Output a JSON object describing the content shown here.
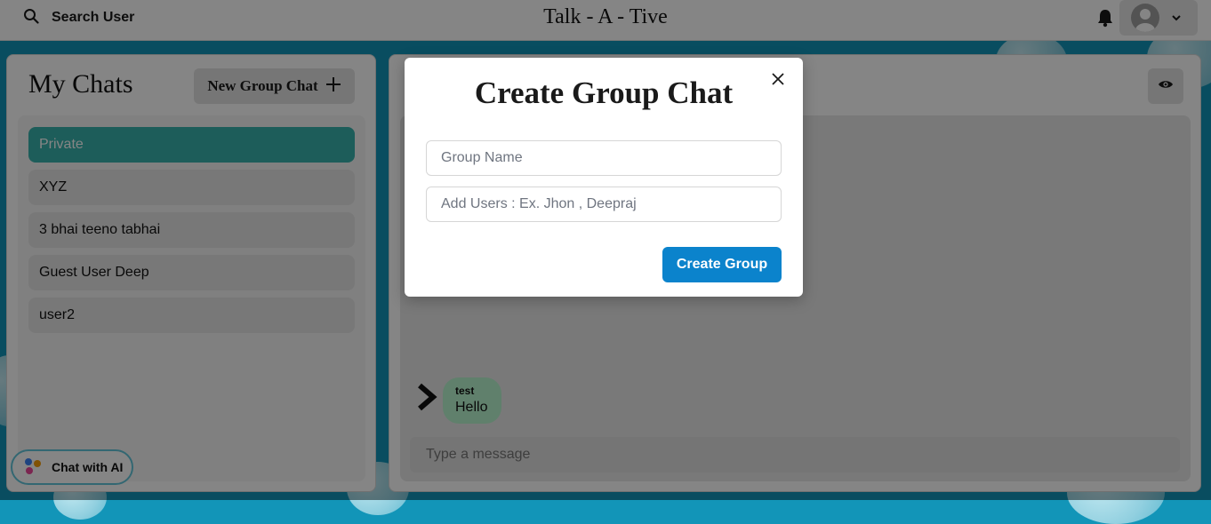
{
  "header": {
    "search_label": "Search User",
    "app_title": "Talk - A - Tive"
  },
  "my_chats": {
    "title": "My Chats",
    "new_group_label": "New Group Chat",
    "items": [
      {
        "label": "Private",
        "active": true
      },
      {
        "label": "XYZ",
        "active": false
      },
      {
        "label": "3 bhai teeno tabhai",
        "active": false
      },
      {
        "label": "Guest User Deep",
        "active": false
      },
      {
        "label": "user2",
        "active": false
      }
    ],
    "ai_button_label": "Chat with AI"
  },
  "chat": {
    "message": {
      "sender": "test",
      "text": "Hello"
    },
    "input_placeholder": "Type a message"
  },
  "modal": {
    "title": "Create Group Chat",
    "group_name_placeholder": "Group Name",
    "add_users_placeholder": "Add Users : Ex. Jhon , Deepraj",
    "create_button_label": "Create Group"
  },
  "colors": {
    "accent_teal": "#38b2ac",
    "primary_blue": "#0b83cc",
    "message_bubble": "#b9f5d0",
    "background": "#1295b8"
  },
  "icons": [
    "search-icon",
    "bell-icon",
    "avatar-icon",
    "chevron-down-icon",
    "plus-icon",
    "eye-icon",
    "close-icon",
    "chevron-right-icon",
    "ai-dots-icon"
  ]
}
